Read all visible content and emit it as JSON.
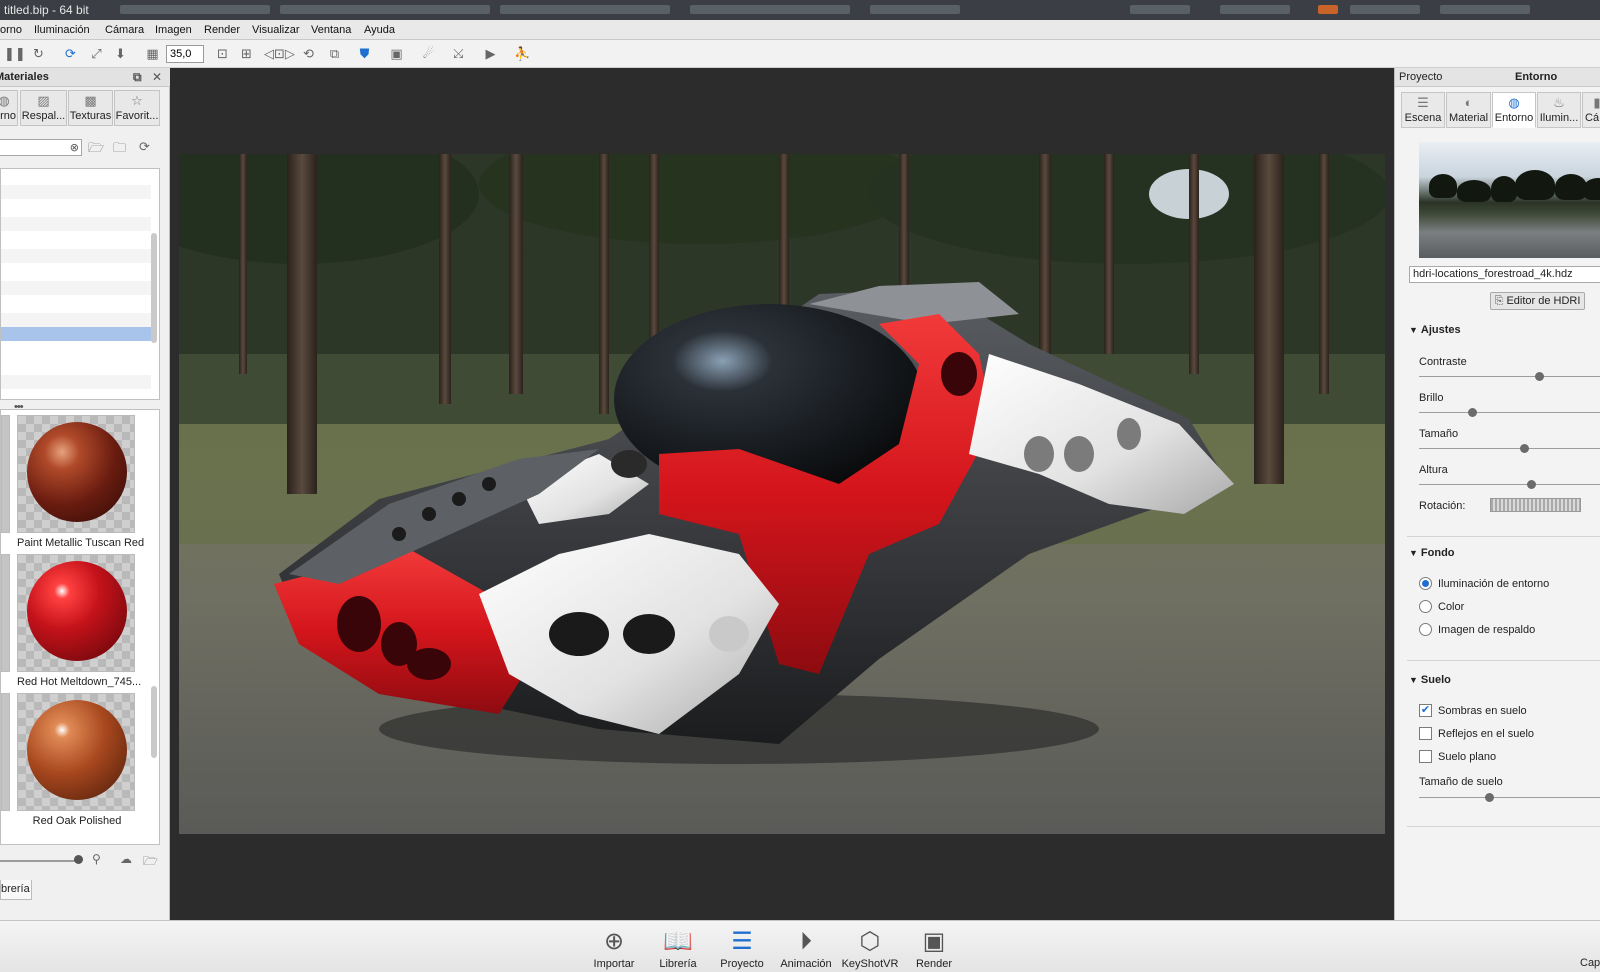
{
  "window": {
    "title": "titled.bip - 64 bit"
  },
  "menu": [
    "orno",
    "Iluminación",
    "Cámara",
    "Imagen",
    "Render",
    "Visualizar",
    "Ventana",
    "Ayuda"
  ],
  "toolbar": {
    "zoom_value": "35,0"
  },
  "library": {
    "title": "Materiales",
    "tabs": [
      {
        "label": "rno",
        "icon": "globe-icon"
      },
      {
        "label": "Respal...",
        "icon": "image-icon"
      },
      {
        "label": "Texturas",
        "icon": "checker-icon"
      },
      {
        "label": "Favorit...",
        "icon": "star-icon"
      }
    ],
    "search_value": "",
    "materials": [
      {
        "name": "Paint Metallic Tuscan Red",
        "color": "#7a2a1a"
      },
      {
        "name": "Red Hot Meltdown_745...",
        "color": "#c4121a"
      },
      {
        "name": "Red Oak Polished",
        "color": "#a8481f"
      }
    ],
    "bottom_tab": "brería"
  },
  "project": {
    "header_left": "Proyecto",
    "header_right": "Entorno",
    "tabs": [
      {
        "label": "Escena",
        "icon": "list-icon",
        "active": false
      },
      {
        "label": "Material",
        "icon": "material-icon",
        "active": false
      },
      {
        "label": "Entorno",
        "icon": "globe-icon",
        "active": true
      },
      {
        "label": "Ilumin...",
        "icon": "bulb-icon",
        "active": false
      },
      {
        "label": "Cá",
        "icon": "camera-icon",
        "active": false
      }
    ],
    "hdri_file": "hdri-locations_forestroad_4k.hdz",
    "hdri_editor_label": "Editor de HDRI",
    "ajustes": {
      "title": "Ajustes",
      "contraste_label": "Contraste",
      "contraste_value": 0.63,
      "brillo_label": "Brillo",
      "brillo_value": 0.28,
      "tamano_label": "Tamaño",
      "tamano_value": 0.55,
      "altura_label": "Altura",
      "altura_value": 0.59,
      "rotacion_label": "Rotación:"
    },
    "fondo": {
      "title": "Fondo",
      "options": [
        {
          "label": "Iluminación de entorno",
          "checked": true
        },
        {
          "label": "Color",
          "checked": false
        },
        {
          "label": "Imagen de respaldo",
          "checked": false
        }
      ]
    },
    "suelo": {
      "title": "Suelo",
      "options": [
        {
          "label": "Sombras en suelo",
          "checked": true
        },
        {
          "label": "Reflejos en el suelo",
          "checked": false
        },
        {
          "label": "Suelo plano",
          "checked": false
        }
      ],
      "size_label": "Tamaño de suelo",
      "size_value": 0.37
    }
  },
  "bottom_bar": {
    "buttons": [
      {
        "label": "Importar",
        "icon": "import-icon"
      },
      {
        "label": "Librería",
        "icon": "book-icon"
      },
      {
        "label": "Proyecto",
        "icon": "project-icon"
      },
      {
        "label": "Animación",
        "icon": "play-icon"
      },
      {
        "label": "KeyShotVR",
        "icon": "cube-icon"
      },
      {
        "label": "Render",
        "icon": "render-icon"
      }
    ],
    "right_text": "Cap"
  }
}
